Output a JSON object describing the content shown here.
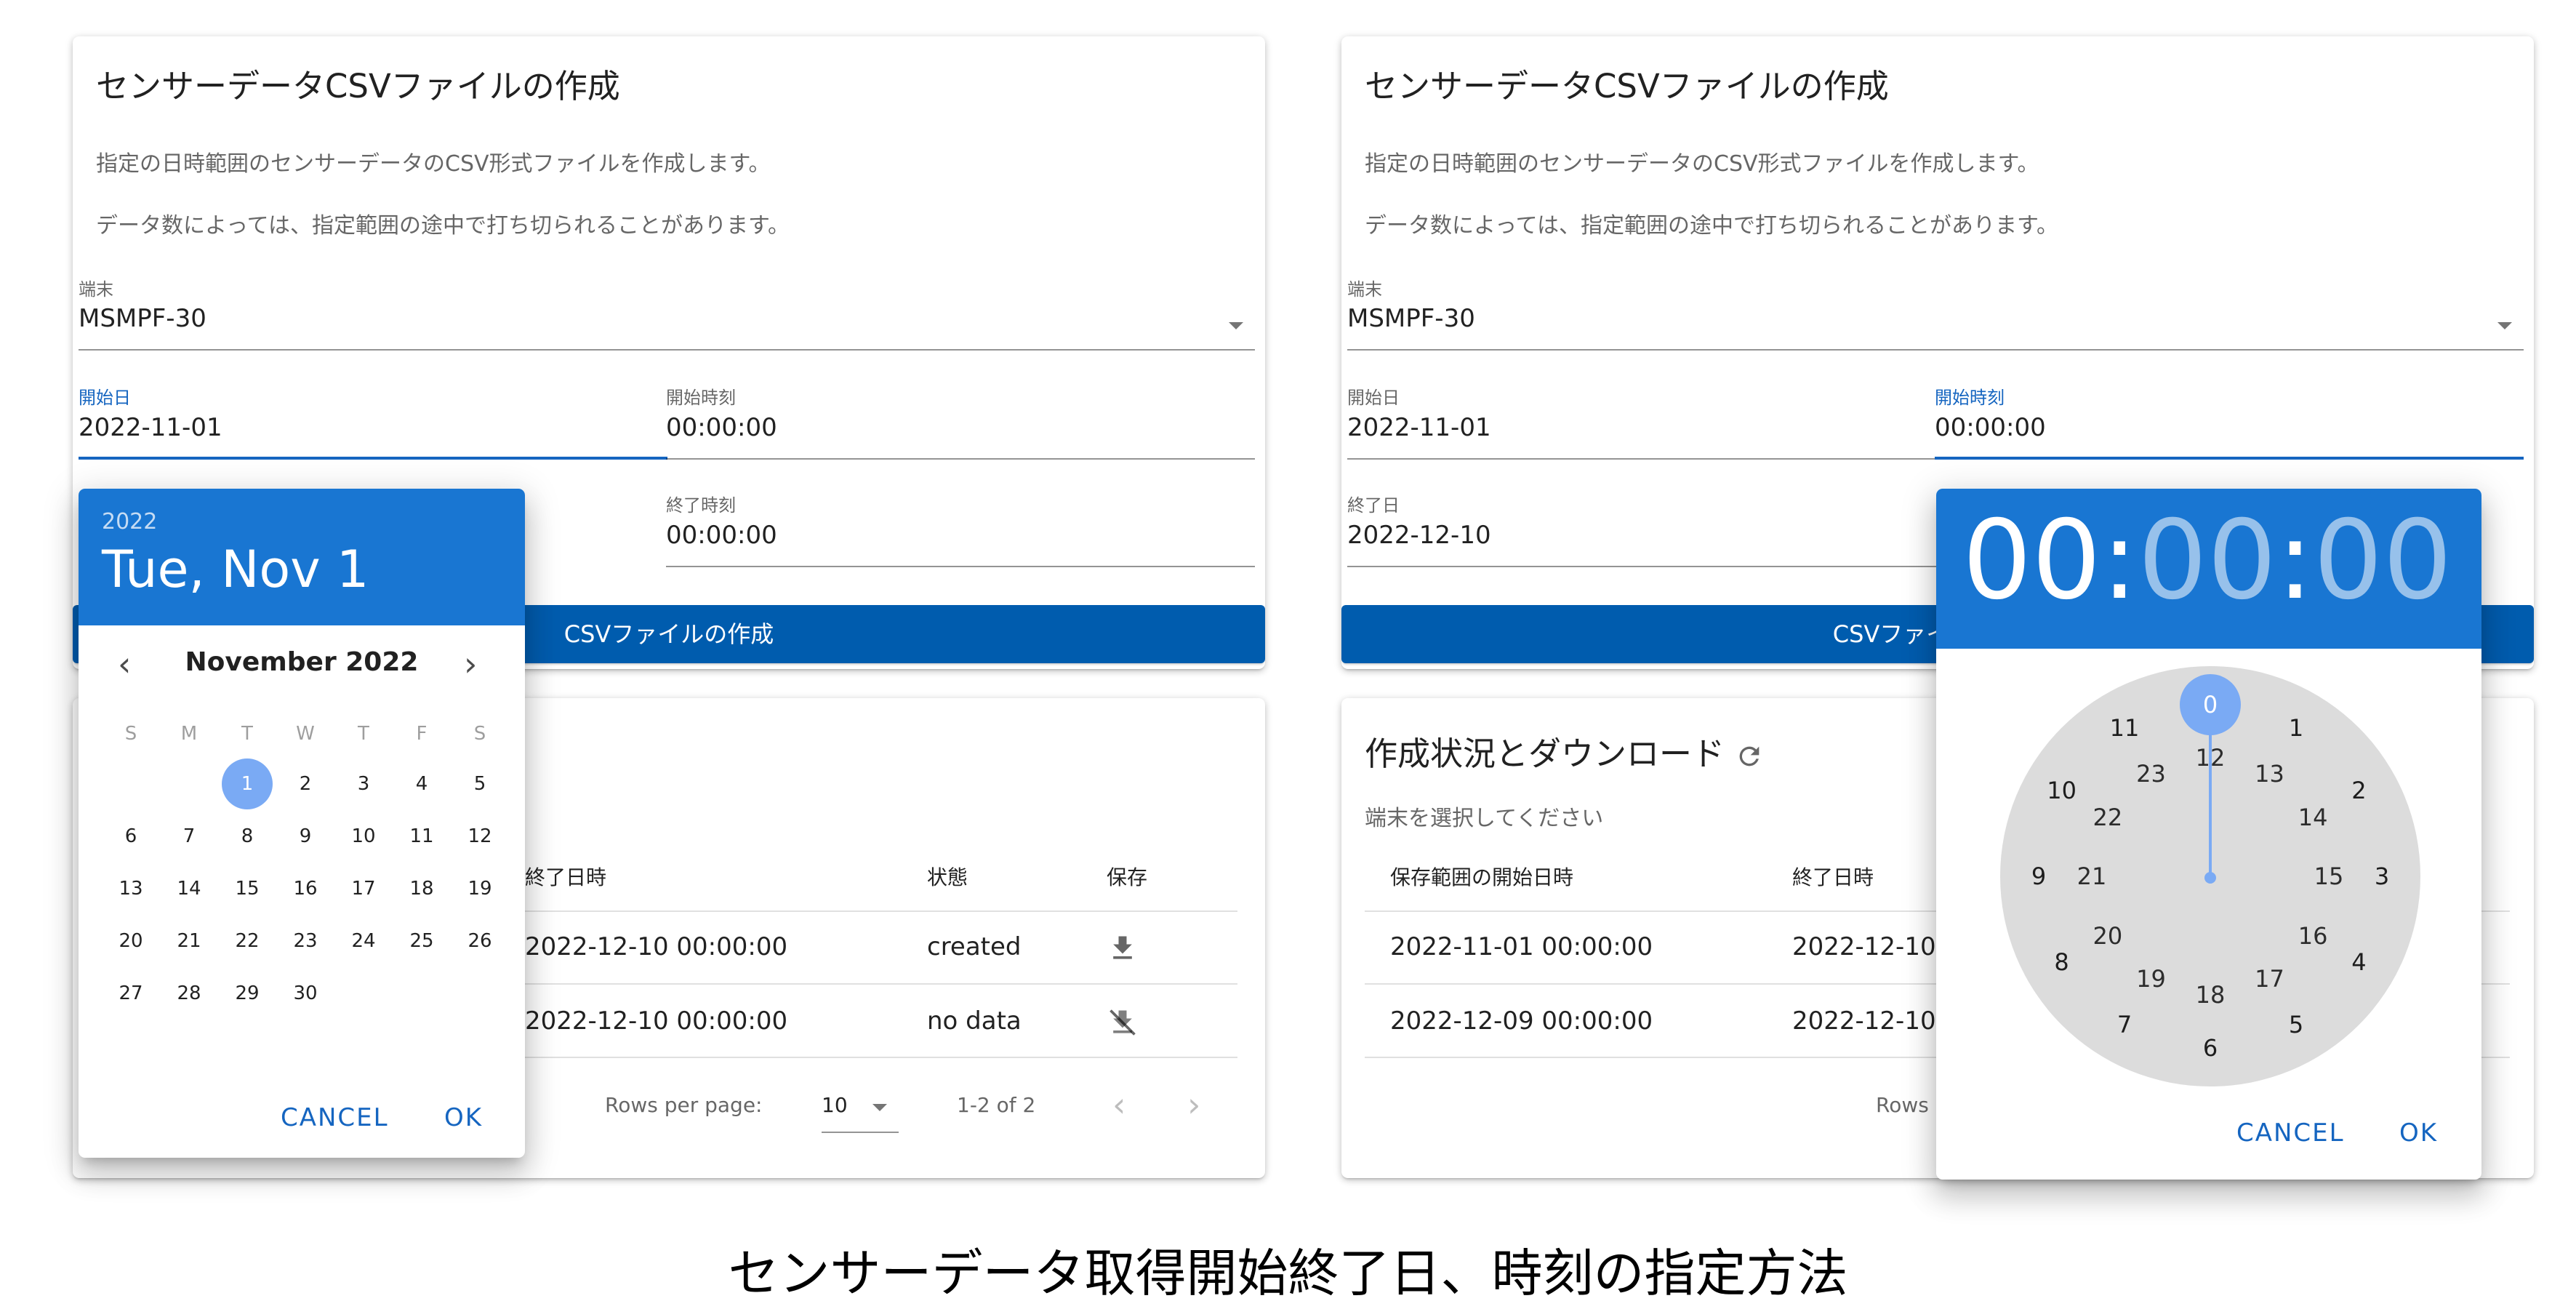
{
  "caption": "センサーデータ取得開始終了日、時刻の指定方法",
  "left": {
    "form": {
      "title": "センサーデータCSVファイルの作成",
      "desc1": "指定の日時範囲のセンサーデータのCSV形式ファイルを作成します。",
      "desc2": "データ数によっては、指定範囲の途中で打ち切られることがあります。",
      "device_label": "端末",
      "device_value": "MSMPF-30",
      "start_date_label": "開始日",
      "start_date_value": "2022-11-01",
      "start_time_label": "開始時刻",
      "start_time_value": "00:00:00",
      "end_time_label": "終了時刻",
      "end_time_value": "00:00:00",
      "create_button": "CSVファイルの作成"
    },
    "table": {
      "headers": [
        "終了日時",
        "状態",
        "保存"
      ],
      "rows": [
        {
          "end": "2022-12-10 00:00:00",
          "status": "created",
          "save_icon": "download-icon"
        },
        {
          "end": "2022-12-10 00:00:00",
          "status": "no data",
          "save_icon": "download-off-icon"
        }
      ],
      "rows_per_page_label": "Rows per page:",
      "rows_per_page_value": "10",
      "range_text": "1-2 of 2"
    },
    "date_picker": {
      "year": "2022",
      "date": "Tue, Nov 1",
      "month_label": "November 2022",
      "weekdays": [
        "S",
        "M",
        "T",
        "W",
        "T",
        "F",
        "S"
      ],
      "first_weekday_index": 2,
      "days_in_month": 30,
      "selected_day": 1,
      "cancel": "CANCEL",
      "ok": "OK"
    }
  },
  "right": {
    "form": {
      "title": "センサーデータCSVファイルの作成",
      "desc1": "指定の日時範囲のセンサーデータのCSV形式ファイルを作成します。",
      "desc2": "データ数によっては、指定範囲の途中で打ち切られることがあります。",
      "device_label": "端末",
      "device_value": "MSMPF-30",
      "start_date_label": "開始日",
      "start_date_value": "2022-11-01",
      "start_time_label": "開始時刻",
      "start_time_value": "00:00:00",
      "end_date_label": "終了日",
      "end_date_value": "2022-12-10",
      "create_button": "CSVファイルの作成"
    },
    "status": {
      "title": "作成状況とダウンロード",
      "hint": "端末を選択してください",
      "headers": [
        "保存範囲の開始日時",
        "終了日時"
      ],
      "rows": [
        {
          "start": "2022-11-01 00:00:00",
          "end": "2022-12-10"
        },
        {
          "start": "2022-12-09 00:00:00",
          "end": "2022-12-10"
        }
      ],
      "rows_label": "Rows"
    },
    "time_picker": {
      "hours": "00",
      "minutes": "00",
      "seconds": "00",
      "separator": ":",
      "outer_numbers": [
        "0",
        "1",
        "2",
        "3",
        "4",
        "5",
        "6",
        "7",
        "8",
        "9",
        "10",
        "11"
      ],
      "inner_numbers": [
        "12",
        "13",
        "14",
        "15",
        "16",
        "17",
        "18",
        "19",
        "20",
        "21",
        "22",
        "23"
      ],
      "selected": "0",
      "cancel": "CANCEL",
      "ok": "OK"
    }
  },
  "colors": {
    "primary": "#1976d2",
    "button": "#005cae",
    "selected": "#7aaaf4",
    "clock_face": "#dcdcdc"
  }
}
